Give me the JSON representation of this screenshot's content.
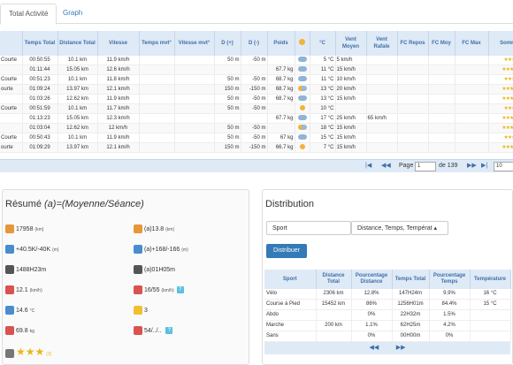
{
  "tabs": [
    {
      "label": "Total Activité"
    },
    {
      "label": "Graph"
    }
  ],
  "table": {
    "headers": [
      "",
      "Temps Total",
      "Distance Total",
      "Vitesse",
      "Temps mvt°",
      "Vitesse mvt°",
      "D (+)",
      "D (-)",
      "Poids",
      "",
      "°C",
      "Vent Moyen",
      "Vent Rafale",
      "FC Repos",
      "FC Moy",
      "FC Max",
      "Somme"
    ],
    "rows": [
      {
        "type": "Courte",
        "temps": "00:50:55",
        "dist": "10.1 km",
        "vit": "11.9 km/h",
        "tm": "",
        "vm": "",
        "dp": "50 m",
        "dm": "-50 m",
        "poids": "",
        "wx": "cloudy",
        "temp": "5 °C",
        "vent": "5 km/h",
        "raf": "",
        "fcr": "",
        "fcm": "",
        "fcx": "",
        "stars": "★★★"
      },
      {
        "type": "",
        "temps": "01:11:44",
        "dist": "15.05 km",
        "vit": "12.6 km/h",
        "tm": "",
        "vm": "",
        "dp": "",
        "dm": "",
        "poids": "67.7 kg",
        "wx": "cloudy",
        "temp": "11 °C",
        "vent": "15 km/h",
        "raf": "",
        "fcr": "",
        "fcm": "",
        "fcx": "",
        "stars": "★★★★"
      },
      {
        "type": "Courte",
        "temps": "00:51:23",
        "dist": "10.1 km",
        "vit": "11.8 km/h",
        "tm": "",
        "vm": "",
        "dp": "50 m",
        "dm": "-50 m",
        "poids": "68.7 kg",
        "wx": "cloudy",
        "temp": "11 °C",
        "vent": "10 km/h",
        "raf": "",
        "fcr": "",
        "fcm": "",
        "fcx": "",
        "stars": "★★★"
      },
      {
        "type": "ourte",
        "temps": "01:09:24",
        "dist": "13.97 km",
        "vit": "12.1 km/h",
        "tm": "",
        "vm": "",
        "dp": "150 m",
        "dm": "-150 m",
        "poids": "68.7 kg",
        "wx": "sunny-cloud",
        "temp": "13 °C",
        "vent": "20 km/h",
        "raf": "",
        "fcr": "",
        "fcm": "",
        "fcx": "",
        "stars": "★★★★"
      },
      {
        "type": "",
        "temps": "01:03:26",
        "dist": "12.62 km",
        "vit": "11.9 km/h",
        "tm": "",
        "vm": "",
        "dp": "50 m",
        "dm": "-50 m",
        "poids": "68.7 kg",
        "wx": "cloudy",
        "temp": "13 °C",
        "vent": "15 km/h",
        "raf": "",
        "fcr": "",
        "fcm": "",
        "fcx": "",
        "stars": "★★★★"
      },
      {
        "type": "Courte",
        "temps": "00:51:59",
        "dist": "10.1 km",
        "vit": "11.7 km/h",
        "tm": "",
        "vm": "",
        "dp": "50 m",
        "dm": "-50 m",
        "poids": "",
        "wx": "sunny",
        "temp": "10 °C",
        "vent": "",
        "raf": "",
        "fcr": "",
        "fcm": "",
        "fcx": "",
        "stars": "★★★"
      },
      {
        "type": "",
        "temps": "01:13:23",
        "dist": "15.05 km",
        "vit": "12.3 km/h",
        "tm": "",
        "vm": "",
        "dp": "",
        "dm": "",
        "poids": "67.7 kg",
        "wx": "cloudy",
        "temp": "17 °C",
        "vent": "25 km/h",
        "raf": "65 km/h",
        "fcr": "",
        "fcm": "",
        "fcx": "",
        "stars": "★★★★"
      },
      {
        "type": "",
        "temps": "01:03:04",
        "dist": "12.62 km",
        "vit": "12 km/h",
        "tm": "",
        "vm": "",
        "dp": "50 m",
        "dm": "-50 m",
        "poids": "",
        "wx": "sunny-cloud",
        "temp": "18 °C",
        "vent": "15 km/h",
        "raf": "",
        "fcr": "",
        "fcm": "",
        "fcx": "",
        "stars": "★★★★"
      },
      {
        "type": "Courte",
        "temps": "00:50:43",
        "dist": "10.1 km",
        "vit": "11.9 km/h",
        "tm": "",
        "vm": "",
        "dp": "50 m",
        "dm": "-50 m",
        "poids": "67 kg",
        "wx": "cloudy",
        "temp": "15 °C",
        "vent": "15 km/h",
        "raf": "",
        "fcr": "",
        "fcm": "",
        "fcx": "",
        "stars": "★★★"
      },
      {
        "type": "ourte",
        "temps": "01:09:29",
        "dist": "13.97 km",
        "vit": "12.1 km/h",
        "tm": "",
        "vm": "",
        "dp": "150 m",
        "dm": "-150 m",
        "poids": "66.7 kg",
        "wx": "sunny",
        "temp": "7 °C",
        "vent": "15 km/h",
        "raf": "",
        "fcr": "",
        "fcm": "",
        "fcx": "",
        "stars": "★★★★"
      }
    ]
  },
  "pager": {
    "page_label": "Page",
    "page": "1",
    "of": "de 139",
    "size": "10"
  },
  "resume": {
    "title": "Résumé",
    "subtitle": "(a)=(Moyenne/Séance)",
    "items": [
      {
        "icon": "distance-icon",
        "text": "17958",
        "unit": "(km)"
      },
      {
        "icon": "avg-distance-icon",
        "text": "(a)13.8",
        "unit": "(km)"
      },
      {
        "icon": "elevation-icon",
        "text": "+40.5K/-40K",
        "unit": "(m)"
      },
      {
        "icon": "avg-elevation-icon",
        "text": "(a)+168/-166",
        "unit": "(m)"
      },
      {
        "icon": "stopwatch-icon",
        "text": "1488H23m",
        "unit": ""
      },
      {
        "icon": "avg-stopwatch-icon",
        "text": "(a)01H05m",
        "unit": ""
      },
      {
        "icon": "speed-icon",
        "text": "12.1",
        "unit": "(km/h)"
      },
      {
        "icon": "wind-icon",
        "text": "16/55",
        "unit": "(km/h)"
      },
      {
        "icon": "temperature-icon",
        "text": "14.6",
        "unit": "°C"
      },
      {
        "icon": "mood-icon",
        "text": "3",
        "unit": ""
      },
      {
        "icon": "weight-icon",
        "text": "69.8",
        "unit": "kg"
      },
      {
        "icon": "heart-rate-icon",
        "text": "54/../..",
        "unit": ""
      },
      {
        "icon": "rating-icon",
        "text": "★★★",
        "unit": "(3)"
      }
    ]
  },
  "distribution": {
    "title": "Distribution",
    "select1": "Sport",
    "select2": "Distance, Temps, Températ",
    "button": "Distribuer",
    "headers": [
      "Sport",
      "Distance Total",
      "Pourcentage Distance",
      "Temps Total",
      "Pourcentage Temps",
      "Température"
    ],
    "rows": [
      [
        "Vélo",
        "2306 km",
        "12.8%",
        "147H24m",
        "9.9%",
        "16 °C"
      ],
      [
        "Course à Pied",
        "15452 km",
        "86%",
        "1256H01m",
        "84.4%",
        "15 °C"
      ],
      [
        "Abdo",
        "",
        "0%",
        "22H32m",
        "1.5%",
        ""
      ],
      [
        "Marche",
        "200 km",
        "1.1%",
        "62H25m",
        "4.2%",
        ""
      ],
      [
        "Sans",
        "",
        "0%",
        "00H00m",
        "0%",
        ""
      ]
    ]
  },
  "colors": {
    "accent": "#337ab7",
    "header_bg": "#dfeaf7",
    "star": "#e8b81a"
  }
}
